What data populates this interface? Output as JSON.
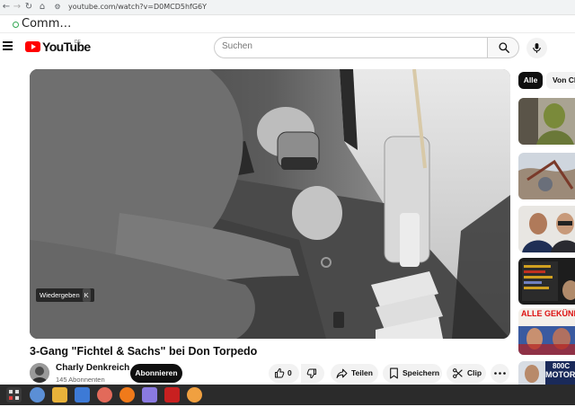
{
  "browser": {
    "url": "youtube.com/watch?v=D0MCD5hfG6Y",
    "bookmark_label": "Comm…"
  },
  "header": {
    "logo_text": "YouTube",
    "logo_region": "DE",
    "search_placeholder": "Suchen"
  },
  "player": {
    "tooltip_label": "Wiedergeben",
    "tooltip_key": "K"
  },
  "video": {
    "title": "3-Gang \"Fichtel & Sachs\" bei Don Torpedo"
  },
  "channel": {
    "name": "Charly Denkreich",
    "subscribers": "145 Abonnenten",
    "subscribe_label": "Abonnieren"
  },
  "actions": {
    "like_count": "0",
    "share_label": "Teilen",
    "save_label": "Speichern",
    "clip_label": "Clip"
  },
  "sidebar": {
    "chips": [
      "Alle",
      "Von Ch"
    ],
    "thumb4_caption": "ALLE GEKÜND",
    "thumb5_caption_top": "800C",
    "thumb5_caption_bottom": "MOTOR"
  },
  "colors": {
    "brand_red": "#ff0000",
    "text_primary": "#0f0f0f",
    "text_secondary": "#606060",
    "pill_bg": "#f2f2f2"
  }
}
